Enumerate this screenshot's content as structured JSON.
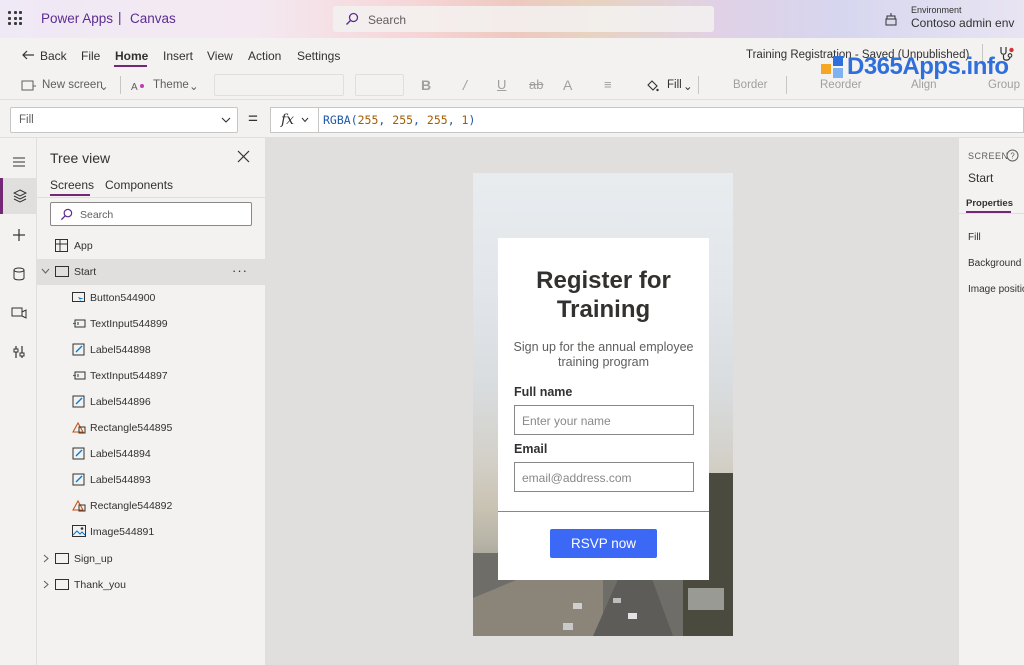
{
  "header": {
    "app_name": "Power Apps",
    "separator": "|",
    "app_type": "Canvas",
    "search_placeholder": "Search",
    "environment_label": "Environment",
    "environment_name": "Contoso admin env"
  },
  "menu": {
    "back": "Back",
    "items": [
      "File",
      "Home",
      "Insert",
      "View",
      "Action",
      "Settings"
    ],
    "active": "Home",
    "status": "Training Registration - Saved (Unpublished)"
  },
  "toolbar": {
    "new_screen": "New screen",
    "theme": "Theme",
    "fill": "Fill",
    "border": "Border",
    "reorder": "Reorder",
    "align": "Align",
    "group": "Group"
  },
  "formula": {
    "property": "Fill",
    "equals": "=",
    "fx": "fx",
    "value": "RGBA(255, 255, 255, 1)"
  },
  "tree": {
    "title": "Tree view",
    "tabs": [
      "Screens",
      "Components"
    ],
    "search_placeholder": "Search",
    "app_node": "App",
    "start_screen": "Start",
    "start_children": [
      {
        "label": "Button544900",
        "icon": "button-icon"
      },
      {
        "label": "TextInput544899",
        "icon": "text-input-icon"
      },
      {
        "label": "Label544898",
        "icon": "label-icon"
      },
      {
        "label": "TextInput544897",
        "icon": "text-input-icon"
      },
      {
        "label": "Label544896",
        "icon": "label-icon"
      },
      {
        "label": "Rectangle544895",
        "icon": "shape-icon"
      },
      {
        "label": "Label544894",
        "icon": "label-icon"
      },
      {
        "label": "Label544893",
        "icon": "label-icon"
      },
      {
        "label": "Rectangle544892",
        "icon": "shape-icon"
      },
      {
        "label": "Image544891",
        "icon": "image-icon"
      }
    ],
    "other_screens": [
      "Sign_up",
      "Thank_you"
    ],
    "more": "···"
  },
  "card": {
    "title": "Register for Training",
    "subtitle": "Sign up for the annual employee training program",
    "name_label": "Full name",
    "name_placeholder": "Enter your name",
    "email_label": "Email",
    "email_placeholder": "email@address.com",
    "button": "RSVP now"
  },
  "properties": {
    "caption": "SCREEN",
    "screen_name": "Start",
    "tab": "Properties",
    "rows": [
      "Fill",
      "Background image",
      "Image position"
    ]
  },
  "watermark": "D365Apps.info",
  "colors": {
    "accent": "#742774",
    "brand_text": "#5c2d91",
    "button": "#3b69f5"
  }
}
